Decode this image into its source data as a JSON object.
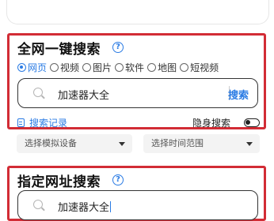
{
  "site_search": {
    "title": "全网一键搜索",
    "help": "?",
    "categories": [
      {
        "label": "网页",
        "selected": true
      },
      {
        "label": "视频",
        "selected": false
      },
      {
        "label": "图片",
        "selected": false
      },
      {
        "label": "软件",
        "selected": false
      },
      {
        "label": "地图",
        "selected": false
      },
      {
        "label": "短视频",
        "selected": false
      }
    ],
    "query": "加速器大全",
    "search_label": "搜索",
    "history_label": "搜索记录",
    "incognito_label": "隐身搜索",
    "incognito_on": false
  },
  "filters": {
    "device": "选择模拟设备",
    "time_range": "选择时间范围"
  },
  "url_search": {
    "title": "指定网址搜索",
    "help": "?",
    "query": "加速器大全"
  },
  "colors": {
    "accent": "#2a7be4",
    "highlight_border": "#d22c35"
  }
}
